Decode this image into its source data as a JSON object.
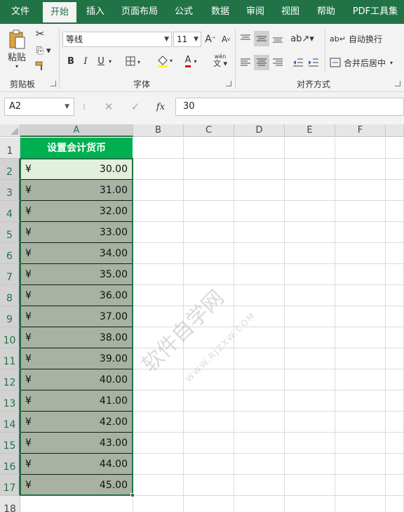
{
  "tabs": [
    "文件",
    "开始",
    "插入",
    "页面布局",
    "公式",
    "数据",
    "审阅",
    "视图",
    "帮助",
    "PDF工具集"
  ],
  "active_tab": "开始",
  "ribbon": {
    "clipboard": {
      "paste_label": "粘贴",
      "group_label": "剪贴板"
    },
    "font": {
      "font_name": "等线",
      "font_size": "11",
      "bold": "B",
      "italic": "I",
      "underline": "U",
      "font_color_letter": "A",
      "phonetic_label": "wén",
      "group_label": "字体"
    },
    "alignment": {
      "wrap_text_label": "自动换行",
      "merge_center_label": "合并后居中",
      "group_label": "对齐方式"
    }
  },
  "formula_bar": {
    "name_box": "A2",
    "cancel": "✕",
    "enter": "✓",
    "fx": "fx",
    "formula": "30"
  },
  "columns": [
    "A",
    "B",
    "C",
    "D",
    "E",
    "F"
  ],
  "rows": [
    "1",
    "2",
    "3",
    "4",
    "5",
    "6",
    "7",
    "8",
    "9",
    "10",
    "11",
    "12",
    "13",
    "14",
    "15",
    "16",
    "17",
    "18"
  ],
  "sheet": {
    "header": "设置会计货币",
    "currency_symbol": "¥",
    "values": [
      "30.00",
      "31.00",
      "32.00",
      "33.00",
      "34.00",
      "35.00",
      "36.00",
      "37.00",
      "38.00",
      "39.00",
      "40.00",
      "41.00",
      "42.00",
      "43.00",
      "44.00",
      "45.00"
    ]
  },
  "watermark": {
    "main": "软件自学网",
    "sub": "WWW.RJZXW.COM"
  },
  "colors": {
    "excel_green": "#217346",
    "header_fill": "#00b050",
    "cell_fill": "#a7b2a2",
    "active_cell_fill": "#e2efda"
  }
}
